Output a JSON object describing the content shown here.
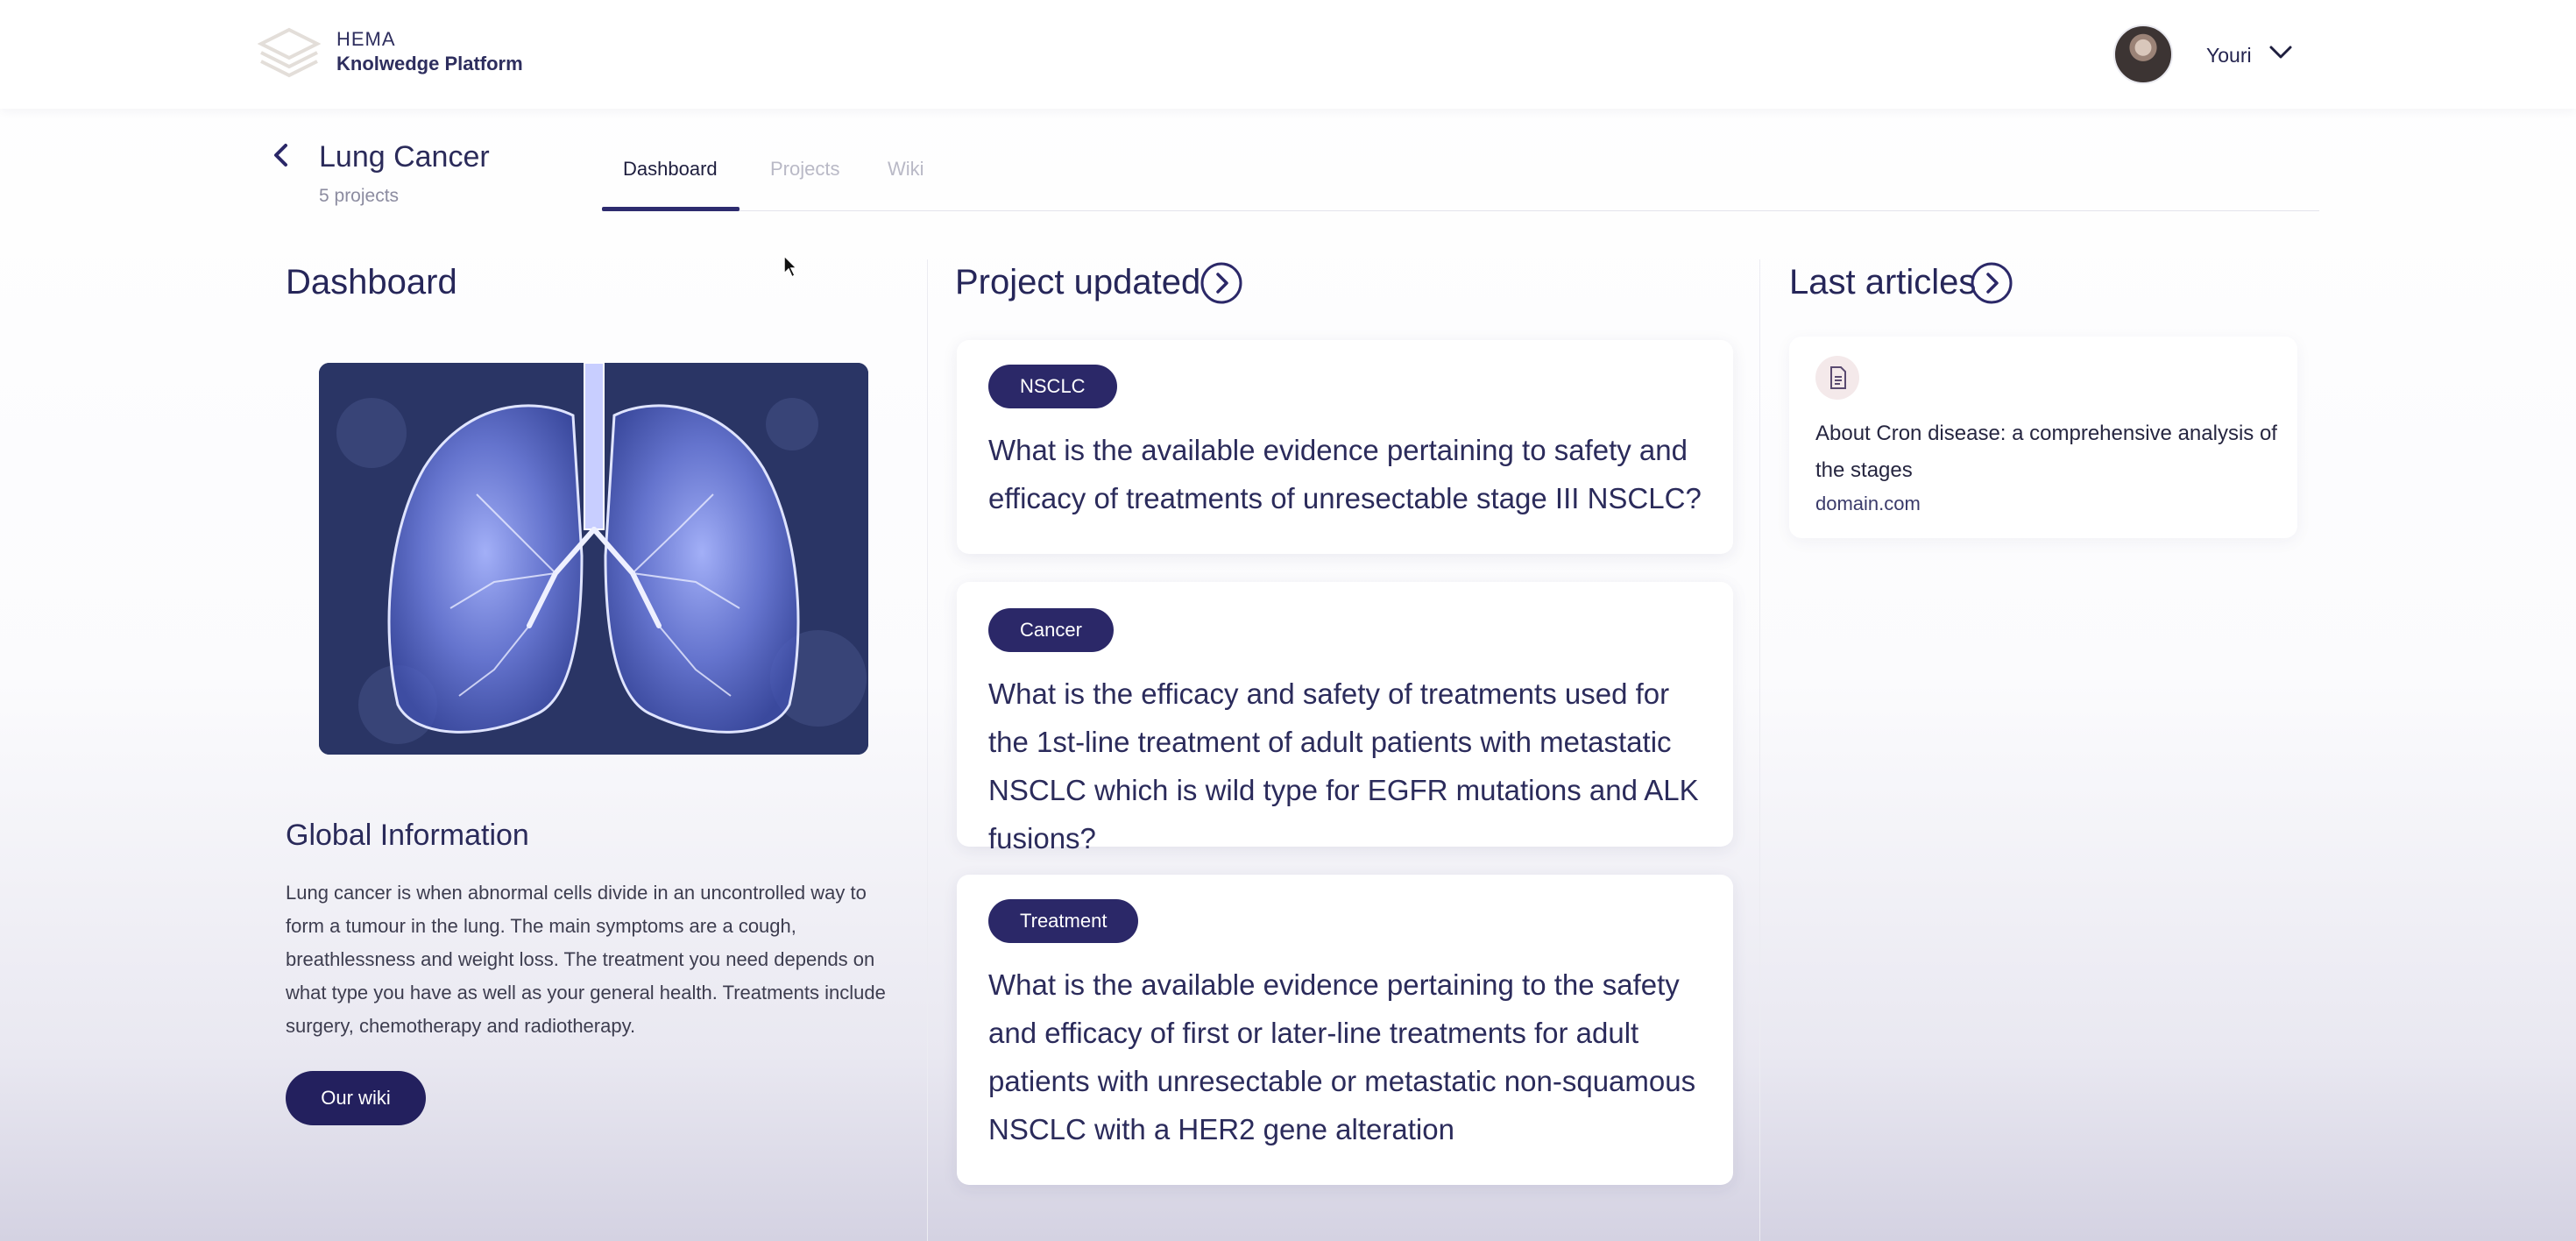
{
  "header": {
    "brand_top": "HEMA",
    "brand_bottom": "Knolwedge Platform",
    "user_name": "Youri"
  },
  "page": {
    "title": "Lung Cancer",
    "subtitle": "5 projects",
    "tabs": [
      {
        "label": "Dashboard",
        "active": true
      },
      {
        "label": "Projects",
        "active": false
      },
      {
        "label": "Wiki",
        "active": false
      }
    ]
  },
  "dashboard": {
    "title": "Dashboard",
    "global_title": "Global Information",
    "global_text": "Lung cancer is when abnormal cells divide in an uncontrolled way to form a tumour in the lung. The main symptoms are a cough, breathlessness and weight loss. The treatment you need depends on what type you have as well as your general health. Treatments include surgery, chemotherapy and radiotherapy.",
    "wiki_button": "Our wiki"
  },
  "projects": {
    "title": "Project updated",
    "items": [
      {
        "tag": "NSCLC",
        "text": "What is the available evidence pertaining to safety and efficacy of treatments of unresectable stage III NSCLC?"
      },
      {
        "tag": "Cancer",
        "text": "What is the efficacy and safety of treatments used for the 1st-line treatment of adult patients with metastatic NSCLC which is wild type for EGFR mutations and ALK fusions?"
      },
      {
        "tag": "Treatment",
        "text": "What is the available evidence pertaining to the safety and efficacy of first or later-line treatments for adult patients with unresectable or metastatic non-squamous NSCLC with a HER2 gene alteration"
      }
    ]
  },
  "articles": {
    "title": "Last articles",
    "items": [
      {
        "title": "About Cron disease: a comprehensive analysis of the stages",
        "domain": "domain.com"
      }
    ]
  },
  "colors": {
    "accent": "#2b2868",
    "text": "#2a2a5c",
    "muted": "#8c8ca0"
  },
  "icons": [
    "logo-mark",
    "avatar",
    "chevron-down-icon",
    "back-arrow-icon",
    "arrow-right-circle-icon",
    "document-icon",
    "mouse-cursor"
  ]
}
